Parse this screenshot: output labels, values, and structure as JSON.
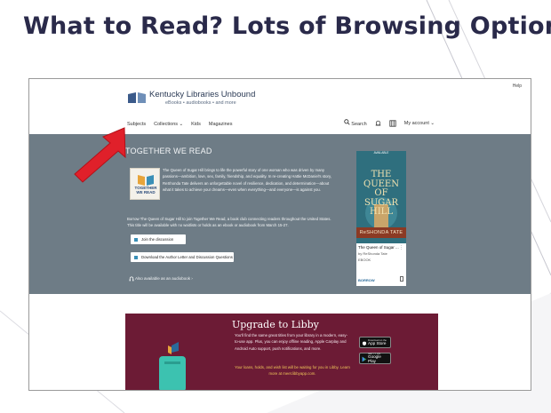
{
  "slide": {
    "title": "What to Read? Lots of Browsing Options"
  },
  "site": {
    "help": "Help",
    "logo_name": "Kentucky Libraries Unbound",
    "logo_tagline": "eBooks • audiobooks • and more",
    "nav": [
      "Subjects",
      "Collections ⌄",
      "Kids",
      "Magazines"
    ],
    "search_label": "Search",
    "account_label": "My account ⌄"
  },
  "hero": {
    "title": "TOGETHER WE READ",
    "badge_text": "TOGETHER\nWE READ",
    "description": "The Queen of Sugar Hill brings to life the powerful story of one woman who was driven by many passions—ambition, love, sex, family, friendship, and equality. In re-creating Hattie McDaniel's story, ReShonda Tate delivers an unforgettable novel of resilience, dedication, and determination—about what it takes to achieve your dreams—even when everything—and everyone—is against you.",
    "description2": "Borrow The Queen of Sugar Hill to join Together We Read, a book club connecting readers throughout the United States. This title will be available with no waitlists or holds as an ebook or audiobook from March 15-27.",
    "join_button": "Join the discussion",
    "download_button": "Download the Author Letter and Discussion Questions",
    "audiobook_link": "Also available as an audiobook ›"
  },
  "book_card": {
    "availability": "AVAILABLE",
    "cover_title": "THE\nQUEEN\nOF\nSUGAR\nHILL",
    "cover_author": "ReSHONDA TATE",
    "title": "The Queen of Sugar ...",
    "author": "by ReShonda Tate",
    "format": "EBOOK",
    "borrow_label": "BORROW"
  },
  "promo": {
    "title": "Upgrade to Libby",
    "body": "You'll find the same great titles from your library in a modern, easy-to-use app. Plus, you can enjoy offline reading, Apple Carplay and Android Auto support, push notifications, and more.",
    "footer": "Your loans, holds, and wish list will be waiting for you in Libby. Learn more at meet.libbyapp.com.",
    "app_store_small": "Download on the",
    "app_store": "App Store",
    "google_small": "GET IT ON",
    "google": "Google Play"
  },
  "colors": {
    "title": "#2a2a4a",
    "hero_bg": "#6e7c86",
    "promo_bg": "#6c1b35",
    "arrow": "#e0202a",
    "cover": "#2f6f7e"
  },
  "icons": [
    "search-icon",
    "bell-icon",
    "library-card-icon",
    "headphones-icon",
    "red-arrow-pointer"
  ]
}
